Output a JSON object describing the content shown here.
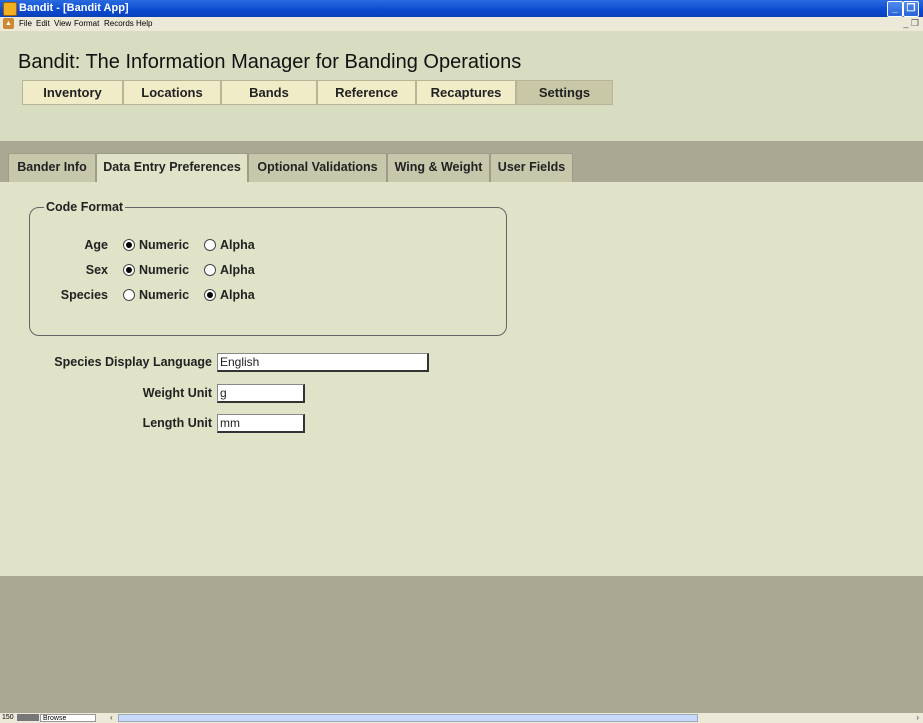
{
  "window": {
    "title": "Bandit - [Bandit App]"
  },
  "menu": [
    "File",
    "Edit",
    "View",
    "Format",
    "Records",
    "Help"
  ],
  "app": {
    "title": "Bandit: The Information Manager for Banding Operations"
  },
  "nav_tabs": [
    {
      "label": "Inventory",
      "active": false
    },
    {
      "label": "Locations",
      "active": false
    },
    {
      "label": "Bands",
      "active": false
    },
    {
      "label": "Reference",
      "active": false
    },
    {
      "label": "Recaptures",
      "active": false
    },
    {
      "label": "Settings",
      "active": true
    }
  ],
  "sub_tabs": [
    {
      "label": "Bander Info",
      "active": false
    },
    {
      "label": "Data Entry Preferences",
      "active": true
    },
    {
      "label": "Optional Validations",
      "active": false
    },
    {
      "label": "Wing & Weight",
      "active": false
    },
    {
      "label": "User Fields",
      "active": false
    }
  ],
  "code_format": {
    "legend": "Code Format",
    "option_numeric": "Numeric",
    "option_alpha": "Alpha",
    "rows": [
      {
        "label": "Age",
        "selected": "Numeric"
      },
      {
        "label": "Sex",
        "selected": "Numeric"
      },
      {
        "label": "Species",
        "selected": "Alpha"
      }
    ]
  },
  "fields": {
    "species_language": {
      "label": "Species Display Language",
      "value": "English"
    },
    "weight_unit": {
      "label": "Weight Unit",
      "value": "g"
    },
    "length_unit": {
      "label": "Length Unit",
      "value": "mm"
    }
  },
  "status": {
    "zoom": "150",
    "view_mode": "Browse"
  }
}
